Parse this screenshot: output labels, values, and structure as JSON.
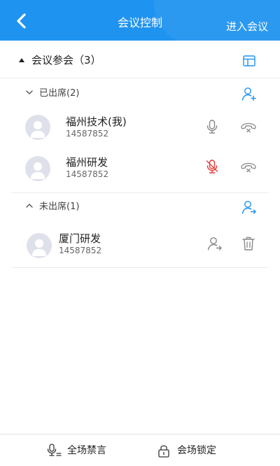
{
  "header": {
    "title": "会议控制",
    "enter_meeting": "进入会议",
    "back_icon": "chevron-left-icon",
    "bg_color": "#1f93f0"
  },
  "summary": {
    "label": "会议参会（3）",
    "layout_icon": "layout-icon"
  },
  "attended": {
    "label": "已出席(2)",
    "action_icon": "add-user-icon",
    "members": [
      {
        "name": "福州技术(我)",
        "number": "14587852",
        "mic": "mic-on",
        "hangup_icon": "hangup-icon"
      },
      {
        "name": "福州研发",
        "number": "14587852",
        "mic": "mic-muted",
        "hangup_icon": "hangup-icon"
      }
    ]
  },
  "absent": {
    "label": "未出席(1)",
    "action_icon": "invite-user-icon",
    "members": [
      {
        "name": "厦门研发",
        "number": "14587852",
        "call_icon": "call-user-icon",
        "delete_icon": "trash-icon"
      }
    ]
  },
  "footer": {
    "mute_all": "全场禁言",
    "lock_meeting": "会场锁定"
  },
  "colors": {
    "accent": "#1f93f0",
    "muted_mic": "#e23b3b",
    "icon_gray": "#888888"
  }
}
